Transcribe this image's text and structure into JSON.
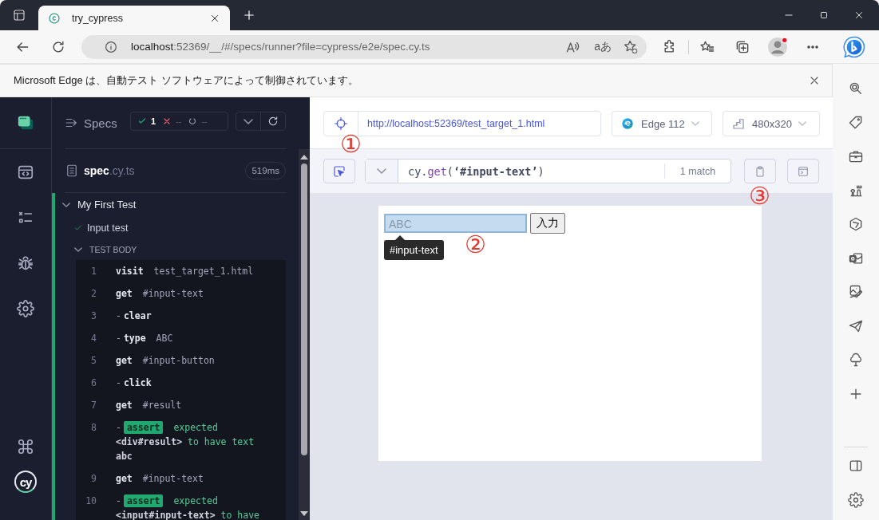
{
  "browser_tab": {
    "title": "try_cypress",
    "selected": true
  },
  "address_bar": {
    "host": "localhost",
    "path": ":52369/__/#/specs/runner?file=cypress/e2e/spec.cy.ts",
    "translate_label": "aあ"
  },
  "infobar": {
    "message": "Microsoft Edge は、自動テスト ソフトウェアによって制御されています。"
  },
  "nav": {
    "logo_text": "cy"
  },
  "reporter": {
    "title": "Specs",
    "passed": "1",
    "failed": "--",
    "pending": "--",
    "spec_name": "spec",
    "spec_ext": ".cy.ts",
    "duration": "519ms",
    "suite": {
      "title": "My First Test",
      "expanded": true
    },
    "test": {
      "title": "Input test",
      "passed": true
    },
    "section": {
      "title": "TEST BODY",
      "expanded": true
    },
    "commands": [
      {
        "number": "1",
        "kind": "command",
        "name": "visit",
        "message": "test_target_1.html"
      },
      {
        "number": "2",
        "kind": "command",
        "name": "get",
        "message": "#input-text"
      },
      {
        "number": "3",
        "kind": "command",
        "prefix": "-",
        "name": "clear"
      },
      {
        "number": "4",
        "kind": "command",
        "prefix": "-",
        "name": "type",
        "message": "ABC"
      },
      {
        "number": "5",
        "kind": "command",
        "name": "get",
        "message": "#input-button"
      },
      {
        "number": "6",
        "kind": "command",
        "prefix": "-",
        "name": "click"
      },
      {
        "number": "7",
        "kind": "command",
        "name": "get",
        "message": "#result"
      },
      {
        "number": "8",
        "kind": "assert",
        "prefix": "-",
        "name": "assert",
        "message": [
          {
            "text": "expected",
            "emphasis": false
          },
          {
            "text": "<div#result>",
            "emphasis": true
          },
          {
            "text": "to have text",
            "emphasis": false
          },
          {
            "text": "abc",
            "emphasis": true
          }
        ]
      },
      {
        "number": "9",
        "kind": "command",
        "name": "get",
        "message": "#input-text"
      },
      {
        "number": "10",
        "kind": "assert",
        "prefix": "-",
        "name": "assert",
        "message": [
          {
            "text": "expected",
            "emphasis": false
          },
          {
            "text": "<input#input-text>",
            "emphasis": true
          },
          {
            "text": "to have",
            "emphasis": false
          }
        ]
      }
    ]
  },
  "runner": {
    "url": "http://localhost:52369/test_target_1.html",
    "browser": "Edge 112",
    "viewport": "480x320",
    "selector": [
      {
        "text": "cy",
        "kind": "object"
      },
      {
        "text": ".",
        "kind": "punct"
      },
      {
        "text": "get",
        "kind": "method"
      },
      {
        "text": "(",
        "kind": "punct"
      },
      {
        "text": "‘#input-text’",
        "kind": "string"
      },
      {
        "text": ")",
        "kind": "punct"
      }
    ],
    "match_count": "1 match"
  },
  "aut": {
    "input_value": "ABC",
    "button_label": "入力",
    "tooltip": "#input-text"
  },
  "annotations": [
    "①",
    "②",
    "③"
  ]
}
